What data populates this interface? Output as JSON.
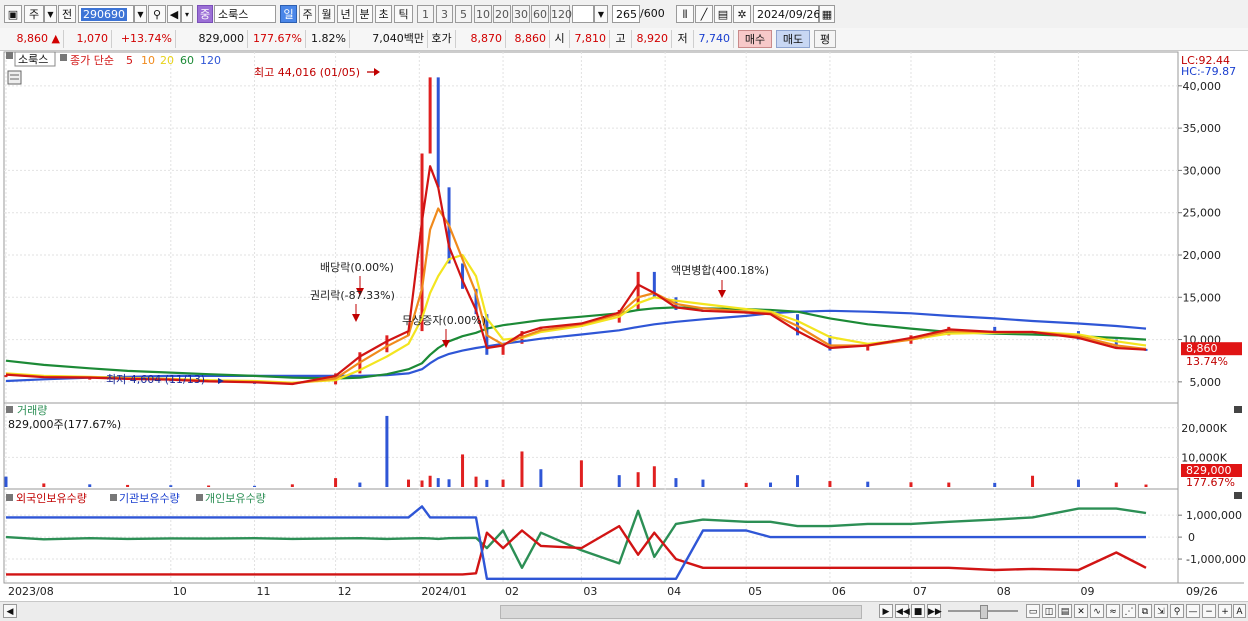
{
  "toolbar": {
    "period_label": "주",
    "prev_label": "전",
    "code": "290690",
    "name_badge": "중",
    "name": "소룩스",
    "tf_day": "일",
    "tf_week": "주",
    "tf_month": "월",
    "tf_year": "년",
    "tf_min": "분",
    "tf_sec": "초",
    "tf_tick": "틱",
    "n1": "1",
    "n3": "3",
    "n5": "5",
    "n10": "10",
    "n20": "20",
    "n30": "30",
    "n60": "60",
    "n120": "120",
    "count": "265",
    "count_max": "/600",
    "date": "2024/09/26"
  },
  "infobar": {
    "price": "8,860",
    "change": "1,070",
    "change_pct": "+13.74%",
    "volume": "829,000",
    "vol_pct": "177.67%",
    "turnover": "1.82%",
    "amount": "7,040백만",
    "ask_label": "호가",
    "ask": "8,870",
    "bid": "8,860",
    "open_label": "시",
    "open": "7,810",
    "high_label": "고",
    "high": "8,920",
    "low_label": "저",
    "low": "7,740",
    "buy": "매수",
    "sell": "매도",
    "even": "평"
  },
  "chart_data": [
    {
      "type": "line",
      "title": "소룩스",
      "series_label": "종가 단순",
      "ma_periods": [
        "5",
        "10",
        "20",
        "60",
        "120"
      ],
      "ma_colors": [
        "#d11414",
        "#f08a1c",
        "#f3e520",
        "#1c8a36",
        "#2f56d6"
      ],
      "dates": [
        "2023-08-01",
        "2023-08-15",
        "2023-09-01",
        "2023-09-15",
        "2023-10-01",
        "2023-10-15",
        "2023-11-01",
        "2023-11-15",
        "2023-12-01",
        "2023-12-10",
        "2023-12-20",
        "2023-12-28",
        "2024-01-02",
        "2024-01-05",
        "2024-01-08",
        "2024-01-12",
        "2024-01-17",
        "2024-01-22",
        "2024-01-26",
        "2024-02-01",
        "2024-02-08",
        "2024-02-15",
        "2024-03-01",
        "2024-03-15",
        "2024-03-22",
        "2024-03-28",
        "2024-04-05",
        "2024-04-15",
        "2024-05-01",
        "2024-05-10",
        "2024-05-20",
        "2024-06-01",
        "2024-06-15",
        "2024-07-01",
        "2024-07-15",
        "2024-08-01",
        "2024-08-15",
        "2024-09-01",
        "2024-09-15",
        "2024-09-26"
      ],
      "close": [
        5800,
        5500,
        5500,
        5300,
        5200,
        5000,
        4900,
        4700,
        6000,
        8500,
        10500,
        11000,
        32000,
        41000,
        28000,
        19000,
        16000,
        13000,
        8200,
        9500,
        11000,
        11500,
        12000,
        13500,
        18000,
        15000,
        13500,
        13300,
        13200,
        13000,
        10500,
        8700,
        9500,
        10500,
        11500,
        10800,
        11000,
        10000,
        8900,
        8860
      ],
      "ma5": [
        5850,
        5550,
        5500,
        5350,
        5250,
        5050,
        4950,
        4750,
        5700,
        8000,
        9800,
        11000,
        24000,
        30500,
        28000,
        21000,
        17000,
        13500,
        9000,
        9300,
        10700,
        11400,
        11900,
        13200,
        16500,
        15500,
        13800,
        13400,
        13200,
        13000,
        11000,
        9000,
        9300,
        10200,
        11200,
        10900,
        10900,
        10200,
        9000,
        8800
      ],
      "ma10": [
        5900,
        5600,
        5550,
        5400,
        5300,
        5100,
        5000,
        4800,
        5400,
        7300,
        9200,
        10500,
        16000,
        23000,
        25500,
        23500,
        19500,
        15500,
        10500,
        9400,
        10300,
        11100,
        11800,
        13000,
        15000,
        15500,
        14200,
        13700,
        13300,
        13100,
        11600,
        9300,
        9300,
        10000,
        11000,
        10900,
        10900,
        10400,
        9300,
        8900
      ],
      "ma20": [
        6000,
        5700,
        5600,
        5450,
        5350,
        5200,
        5100,
        4900,
        5200,
        6400,
        8000,
        9500,
        12500,
        15500,
        17500,
        19500,
        20000,
        17500,
        12500,
        10000,
        10200,
        10900,
        11600,
        12700,
        14300,
        15000,
        14600,
        14200,
        13600,
        13300,
        12200,
        10300,
        9500,
        10000,
        10700,
        10800,
        10900,
        10600,
        9800,
        9300
      ],
      "ma60": [
        7500,
        7000,
        6600,
        6300,
        6100,
        5900,
        5700,
        5500,
        5400,
        5500,
        5900,
        6500,
        7200,
        8200,
        9000,
        9800,
        10400,
        10800,
        11300,
        11700,
        12000,
        12300,
        12700,
        13100,
        13500,
        13700,
        13800,
        13700,
        13600,
        13500,
        13300,
        12500,
        11800,
        11300,
        10900,
        10700,
        10600,
        10400,
        10200,
        10000
      ],
      "ma120": [
        5100,
        5300,
        5500,
        5600,
        5700,
        5700,
        5700,
        5700,
        5700,
        5700,
        5800,
        6000,
        6500,
        7200,
        7800,
        8300,
        8700,
        9000,
        9200,
        9500,
        9800,
        10100,
        10600,
        11100,
        11500,
        11800,
        12100,
        12400,
        12800,
        13100,
        13300,
        13400,
        13300,
        13100,
        12800,
        12500,
        12200,
        11900,
        11600,
        11300
      ],
      "ylim": [
        2500,
        44000
      ],
      "yticks": [
        "5,000",
        "10,000",
        "15,000",
        "20,000",
        "25,000",
        "30,000",
        "35,000",
        "40,000"
      ],
      "xticks": [
        "2023/08",
        "10",
        "11",
        "12",
        "2024/01",
        "02",
        "03",
        "04",
        "05",
        "06",
        "07",
        "08",
        "09",
        "09/26"
      ],
      "annotations": {
        "max_label": "최고 44,016 (01/05)",
        "min_label": "최저 4,604 (11/13)",
        "dividend": "배당락(0.00%)",
        "rights": "권리락(-87.33%)",
        "bonus": "무상증자(0.00%)",
        "split": "액면병합(400.18%)"
      },
      "right_labels": {
        "lc": "LC:92.44",
        "hc": "HC:-79.87",
        "price": "8,860",
        "pct": "13.74%"
      }
    },
    {
      "type": "bar",
      "title": "거래량",
      "value_label": "829,000주(177.67%)",
      "volumes_k": [
        3500,
        1200,
        900,
        700,
        600,
        500,
        400,
        900,
        3000,
        1500,
        24000,
        2500,
        2200,
        3800,
        3000,
        2600,
        11000,
        3500,
        2400,
        2500,
        12000,
        6000,
        9000,
        4000,
        5000,
        7000,
        3000,
        2500,
        1400,
        1500,
        4000,
        2000,
        1800,
        1600,
        1500,
        1400,
        3800,
        2500,
        1500,
        829
      ],
      "up": [
        false,
        true,
        false,
        true,
        false,
        true,
        false,
        true,
        true,
        false,
        false,
        true,
        true,
        true,
        false,
        false,
        true,
        true,
        false,
        true,
        true,
        false,
        true,
        false,
        true,
        true,
        false,
        false,
        true,
        false,
        false,
        true,
        false,
        true,
        true,
        false,
        true,
        false,
        true,
        true
      ],
      "yticks": [
        "10,000K",
        "20,000K"
      ],
      "right_labels": {
        "value": "829,000",
        "pct": "177.67%"
      }
    },
    {
      "type": "line",
      "legend": [
        "외국인보유수량",
        "기관보유수량",
        "개인보유수량"
      ],
      "series_colors": [
        "#d11414",
        "#2f56d6",
        "#2c8f55"
      ],
      "foreign": [
        -1700000,
        -1700000,
        -1700000,
        -1700000,
        -1700000,
        -1700000,
        -1700000,
        -1700000,
        -1700000,
        -1700000,
        -1700000,
        -1700000,
        -1700000,
        -1700000,
        -1700000,
        -1700000,
        -1700000,
        -1650000,
        200000,
        -500000,
        300000,
        -400000,
        -500000,
        500000,
        -800000,
        200000,
        -1000000,
        -1400000,
        -1400000,
        -1400000,
        -1400000,
        -1400000,
        -1400000,
        -1400000,
        -1400000,
        -1500000,
        -1450000,
        -1500000,
        -700000,
        -1400000
      ],
      "institution": [
        900000,
        900000,
        900000,
        900000,
        900000,
        900000,
        900000,
        900000,
        900000,
        900000,
        900000,
        900000,
        1400000,
        900000,
        900000,
        900000,
        900000,
        900000,
        -1900000,
        -1900000,
        -1900000,
        -1900000,
        -1900000,
        -1900000,
        -1900000,
        -1900000,
        -1900000,
        300000,
        300000,
        0,
        0,
        0,
        0,
        0,
        0,
        0,
        0,
        0,
        0,
        0
      ],
      "individual": [
        0,
        -100000,
        -50000,
        -80000,
        -60000,
        -70000,
        -50000,
        -80000,
        -60000,
        -50000,
        -80000,
        -60000,
        -50000,
        -60000,
        -80000,
        -50000,
        -40000,
        -30000,
        -500000,
        300000,
        -1400000,
        200000,
        -600000,
        -1200000,
        1200000,
        -900000,
        600000,
        800000,
        700000,
        700000,
        500000,
        500000,
        600000,
        600000,
        700000,
        800000,
        900000,
        1300000,
        1300000,
        1100000
      ],
      "yticks": [
        "1,000,000",
        "0",
        "-1,000,000"
      ],
      "ylim": [
        -2000000,
        1600000
      ]
    }
  ]
}
